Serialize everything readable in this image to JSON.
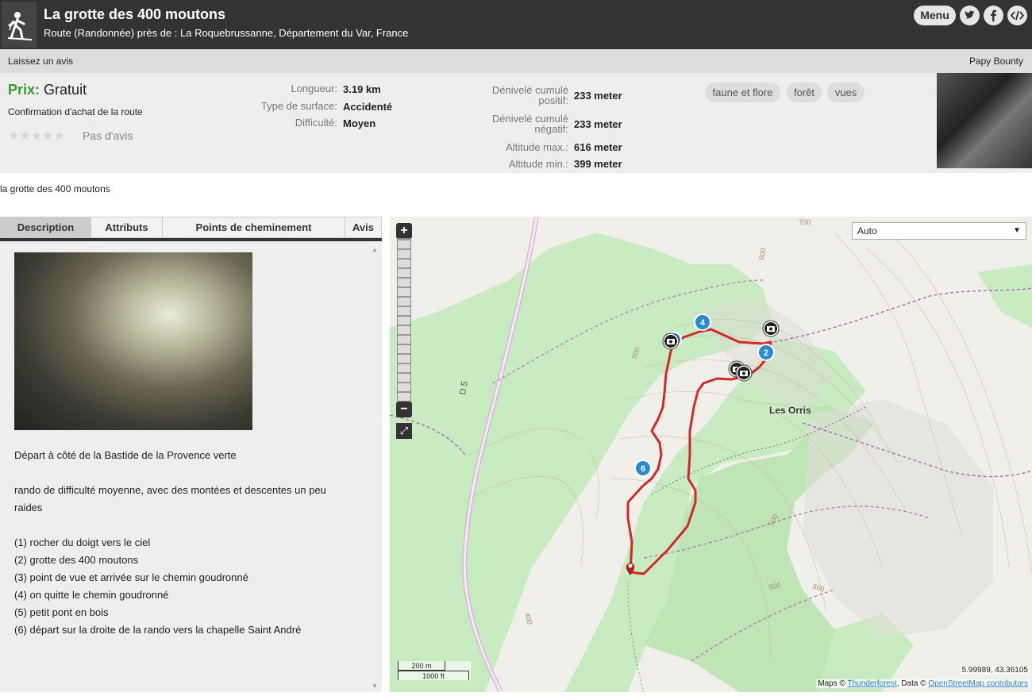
{
  "header": {
    "title": "La grotte des 400 moutons",
    "subtitle": "Route (Randonnée) près de : La Roquebrussanne, Département du Var, France",
    "menu_label": "Menu",
    "icons": [
      "hiker-icon",
      "twitter-icon",
      "facebook-icon",
      "code-icon"
    ]
  },
  "review_bar": {
    "left": "Laissez un avis",
    "right": "Papy Bounty"
  },
  "info": {
    "price_label": "Prix:",
    "price_value": "Gratuit",
    "confirm": "Confirmation d'achat de la route",
    "stars": "★★★★★",
    "no_review": "Pas d'avis",
    "col1": [
      {
        "k": "Longueur:",
        "v": "3.19 km"
      },
      {
        "k": "Type de surface:",
        "v": "Accidenté"
      },
      {
        "k": "Difficulté:",
        "v": "Moyen"
      }
    ],
    "col2": [
      {
        "k1": "Dénivelé cumulé",
        "k2": "positif:",
        "v": "233 meter"
      },
      {
        "k1": "Dénivelé cumulé",
        "k2": "négatif:",
        "v": "233 meter"
      },
      {
        "k": "Altitude max.:",
        "v": "616 meter"
      },
      {
        "k": "Altitude min.:",
        "v": "399 meter"
      }
    ],
    "tags": [
      "faune et flore",
      "forêt",
      "vues"
    ]
  },
  "route_name": "la grotte des 400 moutons",
  "tabs": [
    "Description",
    "Attributs",
    "Points de cheminement",
    "Avis"
  ],
  "description": {
    "lines": [
      "Départ à côté de la Bastide de la Provence verte",
      "rando de difficulté moyenne, avec des montées et descentes un peu",
      "raides",
      "(1) rocher du doigt vers le ciel",
      "(2) grotte des 400 moutons",
      "(3) point de vue et arrivée sur le chemin goudronné",
      "(4) on quitte le chemin goudronné",
      "(5) petit pont en bois",
      "(6) départ sur la droite de la rando vers la chapelle Saint André"
    ]
  },
  "map": {
    "layer_option": "Auto",
    "place_label": "Les Orris",
    "road_label": "D 5",
    "contours": [
      "700",
      "600",
      "500",
      "500",
      "500",
      "500",
      "400"
    ],
    "markers": [
      "4",
      "2",
      "6"
    ],
    "scale_m": "200 m",
    "scale_ft": "1000 ft",
    "coords": "5.99989, 43.36105",
    "attrib_prefix": "Maps ©",
    "attrib_link1": "Thunderforest",
    "attrib_mid": ", Data ©",
    "attrib_link2": "OpenStreetMap contributors",
    "route_color": "#d22a2a",
    "forest_color": "#c6e9c0"
  }
}
